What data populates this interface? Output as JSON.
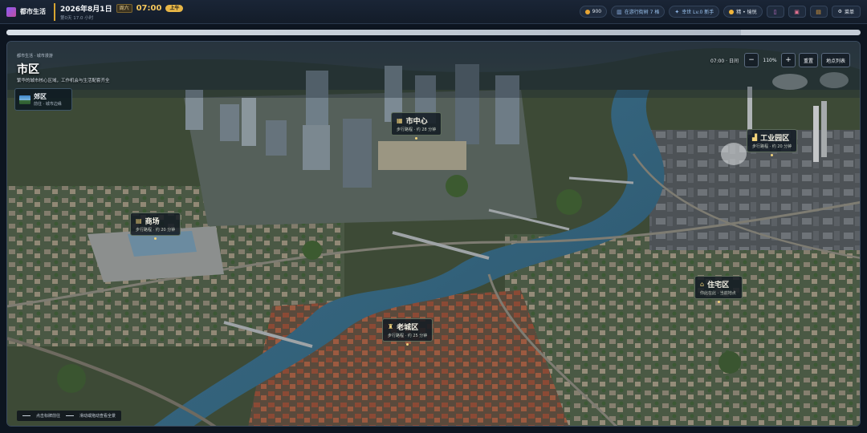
{
  "app": {
    "title": "都市生活"
  },
  "date": {
    "date": "2026年8月1日",
    "weekday": "周六",
    "time": "07:00",
    "period": "上午",
    "info": "第0天 17.0 小时"
  },
  "status": {
    "money": "900",
    "calendar": "在游行街树 7 格",
    "level": "幸世 Lv.0 新手",
    "mood": "精 • 愉悦"
  },
  "menu": {
    "label": "菜单"
  },
  "progress": {
    "fraction": 0.86
  },
  "map": {
    "breadcrumb": "都市生活 · 城市漫游",
    "title": "市区",
    "subtitle": "繁华的城市核心区域，工作机会与生活配套齐全",
    "time_label": "07:00 · 日间",
    "zoom": "110%",
    "reset_label": "重置",
    "list_label": "地点列表",
    "zoom_out": "−",
    "zoom_in": "+"
  },
  "suburb": {
    "name": "郊区",
    "meta": "前往 · 城市边缘"
  },
  "locations": [
    {
      "name": "市中心",
      "meta": "步行路程 · 约 28 分钟",
      "icon": "building-icon"
    },
    {
      "name": "工业园区",
      "meta": "步行路程 · 约 20 分钟",
      "icon": "factory-icon"
    },
    {
      "name": "商场",
      "meta": "步行路程 · 约 20 分钟",
      "icon": "shop-icon"
    },
    {
      "name": "住宅区",
      "meta": "你此在此 · 当前地点",
      "icon": "home-icon"
    },
    {
      "name": "老城区",
      "meta": "步行路程 · 约 25 分钟",
      "icon": "oldtown-icon"
    }
  ],
  "legend": {
    "item1": "点击标牌前往",
    "item2": "滑动或拖动查看全景"
  },
  "colors": {
    "accent": "#e7b646",
    "panel": "#131c29"
  }
}
